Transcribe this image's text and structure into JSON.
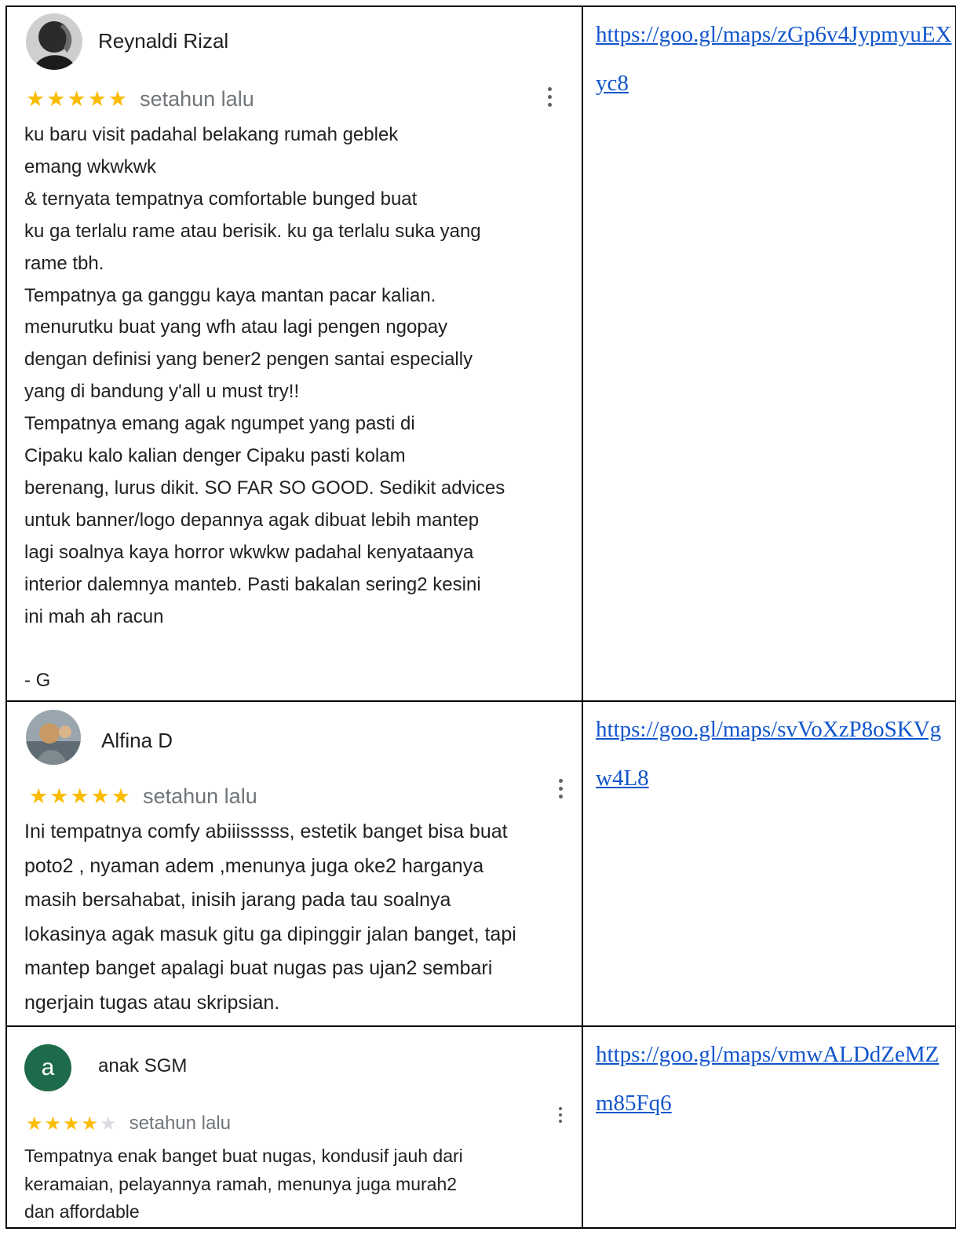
{
  "reviews": [
    {
      "name": "Reynaldi Rizal",
      "stars": 5,
      "time": "setahun lalu",
      "text": "ku baru visit padahal belakang rumah geblek\nemang wkwkwk\n& ternyata tempatnya comfortable bunged buat\nku ga terlalu rame atau berisik. ku ga terlalu suka yang\nrame tbh.\nTempatnya ga ganggu kaya mantan pacar kalian.\nmenurutku buat yang wfh atau lagi pengen ngopay\ndengan definisi yang bener2 pengen santai especially\nyang di bandung y'all u must try!!\nTempatnya emang agak ngumpet yang pasti di\nCipaku kalo kalian denger Cipaku pasti kolam\nberenang, lurus dikit. SO FAR SO GOOD. Sedikit advices\nuntuk banner/logo depannya agak dibuat lebih mantep\nlagi soalnya kaya horror wkwkw padahal kenyataanya\ninterior dalemnya manteb. Pasti bakalan sering2 kesini\nini mah ah racun\n\n- G",
      "link": "https://goo.gl/maps/zGp6v4JypmyuEXyc8",
      "avatar_icon": "avatar-photo-dark",
      "star_icon": "star-icon"
    },
    {
      "name": "Alfina D",
      "stars": 5,
      "time": "setahun lalu",
      "text": "Ini tempatnya comfy abiiisssss, estetik banget bisa buat\npoto2 , nyaman adem ,menunya juga oke2 harganya\nmasih bersahabat, inisih jarang pada tau soalnya\nlokasinya agak masuk gitu ga dipinggir jalan banget, tapi\nmantep banget apalagi buat nugas pas ujan2 sembari\nngerjain tugas atau skripsian.",
      "link": "https://goo.gl/maps/svVoXzP8oSKVgw4L8",
      "avatar_icon": "avatar-photo-cat",
      "star_icon": "star-icon"
    },
    {
      "name": "anak SGM",
      "stars": 4,
      "time": "setahun lalu",
      "text": "Tempatnya enak banget buat nugas, kondusif jauh dari\nkeramaian, pelayannya ramah, menunya juga murah2\ndan affordable",
      "link": "https://goo.gl/maps/vmwALDdZeMZm85Fq6",
      "avatar_letter": "a",
      "avatar_color": "#1e6b4b",
      "star_icon": "star-icon"
    }
  ],
  "colors": {
    "star_on": "#fbbc04",
    "star_off": "#dadce0",
    "link": "#1155cc"
  }
}
